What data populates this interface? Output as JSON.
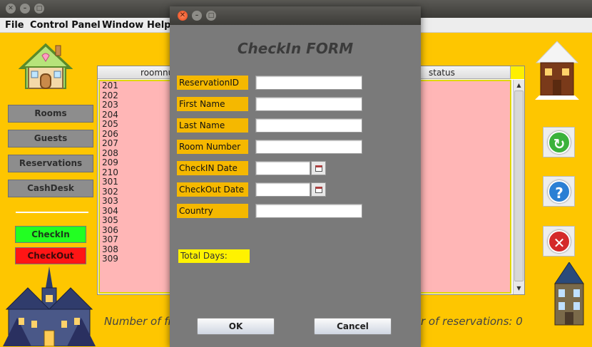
{
  "menu": [
    "File",
    "Control Panel",
    "Window",
    "Help"
  ],
  "sidebar": {
    "nav": [
      "Rooms",
      "Guests",
      "Reservations",
      "CashDesk"
    ],
    "checkin_label": "CheckIn",
    "checkout_label": "CheckOut",
    "colors": {
      "checkin": "#22ff22",
      "checkout": "#ff1515",
      "nav": "#8d8d8d"
    }
  },
  "table": {
    "headers": [
      "roomnu",
      "status"
    ],
    "rows": [
      "201",
      "202",
      "203",
      "204",
      "205",
      "206",
      "207",
      "208",
      "209",
      "210",
      "301",
      "302",
      "303",
      "304",
      "305",
      "306",
      "307",
      "308",
      "309"
    ],
    "row_color": "#ffb6b6"
  },
  "status_bar": {
    "free_rooms_text": "Number of fr",
    "reservations_text": "r of reservations: 0"
  },
  "icons": {
    "refresh": "refresh-icon",
    "help": "help-icon",
    "close": "close-icon"
  },
  "dialog": {
    "form_title": "CheckIn FORM",
    "fields": [
      {
        "label": "ReservationID",
        "value": ""
      },
      {
        "label": "First Name",
        "value": ""
      },
      {
        "label": "Last Name",
        "value": ""
      },
      {
        "label": "Room Number",
        "value": ""
      },
      {
        "label": "CheckIN Date",
        "value": ""
      },
      {
        "label": "CheckOut Date",
        "value": ""
      },
      {
        "label": "Country",
        "value": ""
      }
    ],
    "total_days_label": "Total Days:",
    "ok_label": "OK",
    "cancel_label": "Cancel",
    "colors": {
      "label_bg": "#f5b800",
      "total_bg": "#fff200",
      "dialog_bg": "#7a7a7a"
    }
  }
}
